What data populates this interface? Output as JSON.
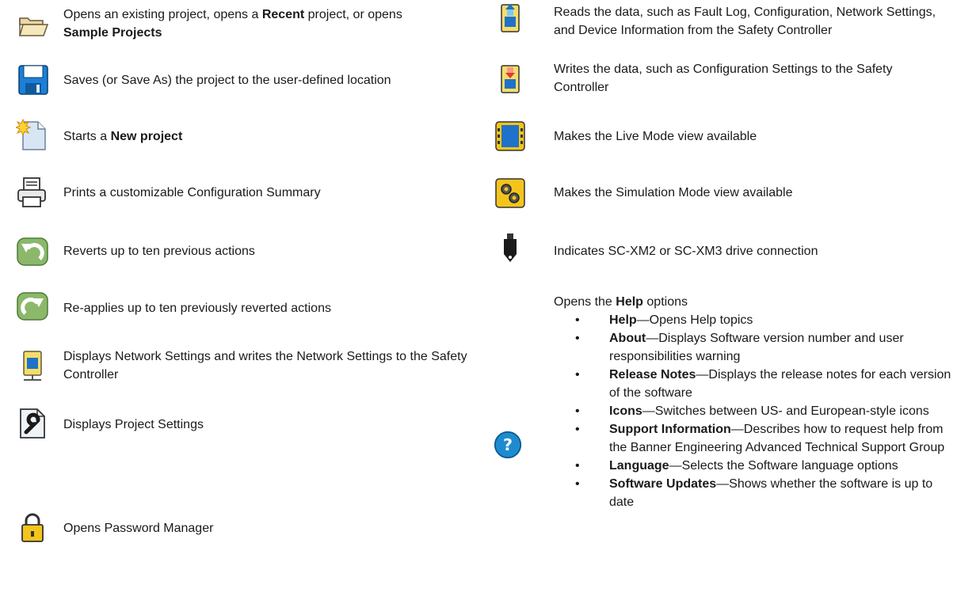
{
  "left": {
    "open": {
      "pre": "Opens an existing project, opens a ",
      "b1": "Recent",
      "mid": " project, or opens ",
      "b2": "Sample Projects"
    },
    "save": "Saves (or Save As) the project to the user-defined location",
    "new": {
      "pre": "Starts a ",
      "b": "New project"
    },
    "print": "Prints a customizable Configuration Summary",
    "undo": "Reverts up to ten previous actions",
    "redo": "Re-applies up to ten previously reverted actions",
    "network": "Displays Network Settings and writes the Network Settings to the Safety Controller",
    "project_settings": "Displays Project Settings",
    "password": "Opens Password Manager"
  },
  "right": {
    "read": "Reads the data, such as Fault Log, Configuration, Network Settings, and Device Information from the Safety Controller",
    "write": "Writes the data, such as Configuration Settings to the Safety Controller",
    "live": "Makes the Live Mode view available",
    "simulation": "Makes the Simulation Mode view available",
    "drive": "Indicates SC-XM2 or SC-XM3 drive connection",
    "help": {
      "pre": "Opens the ",
      "b": "Help",
      "post": " options",
      "bullet": "•",
      "items": [
        {
          "term": "Help",
          "text": "—Opens Help topics"
        },
        {
          "term": "About",
          "text": "—Displays Software version number and user responsibilities warning"
        },
        {
          "term": "Release Notes",
          "text": "—Displays the release notes for each version of the software"
        },
        {
          "term": "Icons",
          "text": "—Switches between US- and European-style icons"
        },
        {
          "term": "Support Information",
          "text": "—Describes how to request help from the Banner Engineering Advanced Technical Support Group"
        },
        {
          "term": "Language",
          "text": "—Selects the Software language options"
        },
        {
          "term": "Software Updates",
          "text": "—Shows whether the software is up to date"
        }
      ]
    }
  },
  "icons": [
    "open-folder-icon",
    "save-disk-icon",
    "new-project-icon",
    "printer-icon",
    "undo-icon",
    "redo-icon",
    "network-settings-icon",
    "project-settings-icon",
    "padlock-icon",
    "read-from-controller-icon",
    "write-to-controller-icon",
    "live-mode-icon",
    "simulation-mode-icon",
    "usb-drive-icon",
    "help-icon"
  ]
}
